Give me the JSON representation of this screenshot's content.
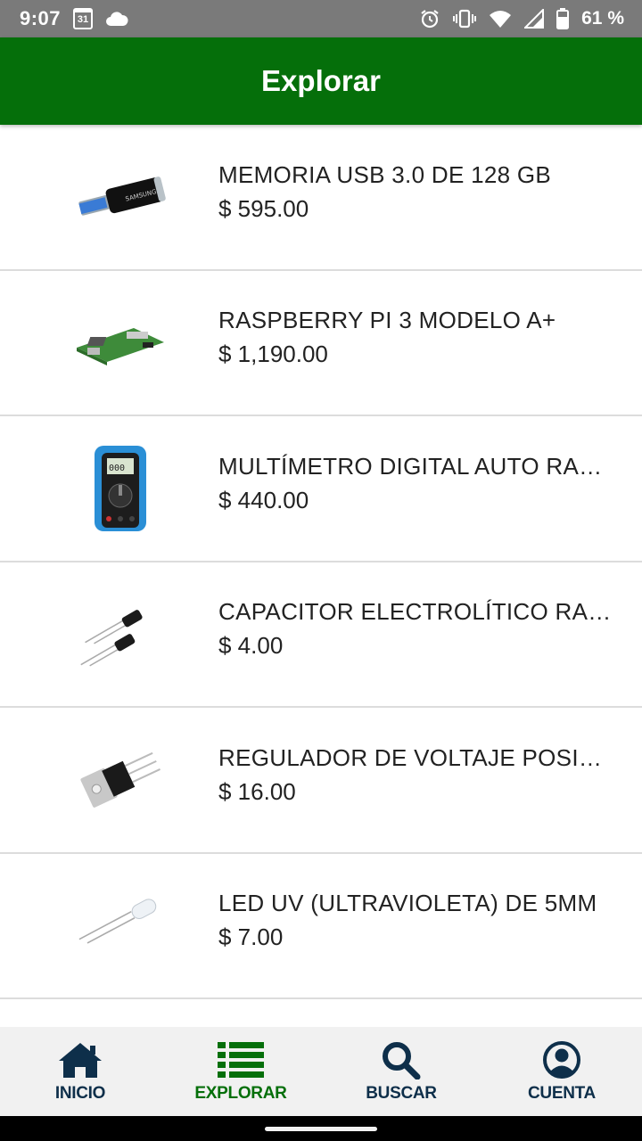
{
  "status_bar": {
    "time": "9:07",
    "calendar_day": "31",
    "battery": "61 %",
    "icons": [
      "calendar-icon",
      "cloud-icon",
      "alarm-icon",
      "vibrate-icon",
      "wifi-icon",
      "signal-icon",
      "battery-icon"
    ]
  },
  "app_bar": {
    "title": "Explorar",
    "color": "#056f0a"
  },
  "products": [
    {
      "name": "MEMORIA USB 3.0 DE 128 GB",
      "price": "$ 595.00",
      "image": "usb-drive-image"
    },
    {
      "name": "RASPBERRY PI 3 MODELO A+",
      "price": "$ 1,190.00",
      "image": "raspberry-pi-image"
    },
    {
      "name": "MULTÍMETRO DIGITAL AUTO RANGO",
      "price": "$ 440.00",
      "image": "multimeter-image"
    },
    {
      "name": "CAPACITOR ELECTROLÍTICO RADIAL",
      "price": "$ 4.00",
      "image": "capacitor-image"
    },
    {
      "name": "REGULADOR DE VOLTAJE POSITIVO",
      "price": "$ 16.00",
      "image": "voltage-regulator-image"
    },
    {
      "name": "LED UV (ULTRAVIOLETA) DE 5MM",
      "price": "$ 7.00",
      "image": "led-image"
    }
  ],
  "bottom_nav": {
    "items": [
      {
        "label": "INICIO",
        "icon": "home-icon",
        "active": false
      },
      {
        "label": "EXPLORAR",
        "icon": "list-icon",
        "active": true
      },
      {
        "label": "BUSCAR",
        "icon": "search-icon",
        "active": false
      },
      {
        "label": "CUENTA",
        "icon": "account-icon",
        "active": false
      }
    ],
    "active_color": "#056f0a",
    "inactive_color": "#0e2f4a"
  }
}
